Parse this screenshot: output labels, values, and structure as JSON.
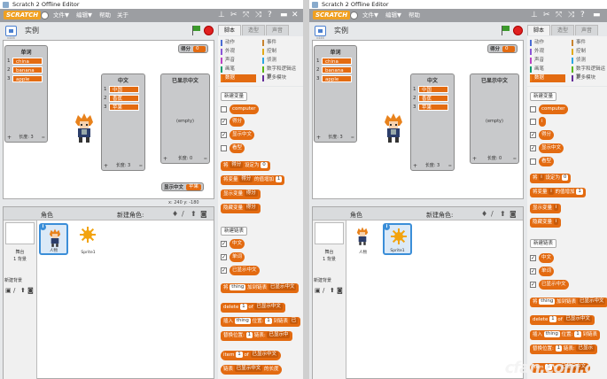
{
  "left": {
    "app_title": "Scratch 2 Offline Editor",
    "logo": "SCRATCH",
    "menu": {
      "file": "文件▼",
      "edit": "编辑▼",
      "help": "帮助",
      "about": "关于"
    },
    "stage_name": "实例",
    "version": "v446",
    "monitors": {
      "list1": {
        "title": "单词",
        "items": [
          "china",
          "banana",
          "apple"
        ],
        "length": "长度: 3"
      },
      "list2": {
        "title": "中文",
        "items": [
          "中国",
          "香蕉",
          "苹果"
        ],
        "length": "长度: 3"
      },
      "list3": {
        "title": "已显示中文",
        "empty": "(empty)",
        "length": "长度: 0"
      },
      "score_label": "得分",
      "score_value": "0",
      "show_label": "显示中文",
      "show_value": "苹果"
    },
    "coords": "x: 240  y: -180",
    "sprites_label": "角色",
    "new_sprite": "新建角色:",
    "stage_thumb": {
      "label": "舞台",
      "bg_count": "1 背景",
      "new_bg": "新建背景"
    },
    "sprites": [
      {
        "name": "人物"
      },
      {
        "name": "Sprite1"
      }
    ],
    "tabs": [
      "脚本",
      "造型",
      "声音"
    ],
    "categories": [
      {
        "label": "动作",
        "color": "#4a6cd4"
      },
      {
        "label": "事件",
        "color": "#c88330"
      },
      {
        "label": "外观",
        "color": "#8a55d7"
      },
      {
        "label": "控制",
        "color": "#e1a91a"
      },
      {
        "label": "声音",
        "color": "#bb42c3"
      },
      {
        "label": "侦测",
        "color": "#2ca5e2"
      },
      {
        "label": "画笔",
        "color": "#0e9a6c"
      },
      {
        "label": "数字和逻辑运算",
        "color": "#5cb712"
      },
      {
        "label": "数据",
        "color": "#ee7d16"
      },
      {
        "label": "更多模块",
        "color": "#632d99"
      }
    ],
    "palette": {
      "new_var": "新建变量",
      "vars": [
        "computer",
        "得分",
        "显示中文",
        "看型"
      ],
      "set_block": [
        "将",
        "得分",
        "设定为",
        "0"
      ],
      "change_block": [
        "将变量",
        "得分",
        "的值增加",
        "1"
      ],
      "show_var": [
        "显示变量",
        "得分"
      ],
      "hide_var": [
        "隐藏变量",
        "得分"
      ],
      "new_list": "新建链表",
      "lists": [
        "中文",
        "单词",
        "已显示中文"
      ],
      "add_block": [
        "将",
        "thing",
        "加到链表",
        "已显示中文"
      ],
      "delete_block": [
        "delete",
        "1",
        "of",
        "已显示中文"
      ],
      "insert_block": [
        "插入",
        "thing",
        "位置:",
        "1",
        "到链表",
        "已"
      ],
      "replace_block": [
        "替换位置:",
        "1",
        "链表:",
        "已显示中"
      ],
      "item_block": [
        "item",
        "1",
        "of",
        "已显示中文"
      ],
      "length_block": [
        "链表",
        "已显示中文",
        "的长度"
      ]
    }
  },
  "right": {
    "app_title": "Scratch 2 Offline Editor",
    "logo": "SCRATCH",
    "menu": {
      "file": "文件▼",
      "edit": "编辑▼",
      "help": "帮助"
    },
    "stage_name": "实例",
    "version": "v446",
    "monitors": {
      "list1": {
        "title": "单词",
        "items": [
          "china",
          "banana",
          "apple"
        ],
        "length": "长度: 3"
      },
      "list2": {
        "title": "中文",
        "items": [
          "中国",
          "香蕉",
          "苹果"
        ],
        "length": "长度: 3"
      },
      "list3": {
        "title": "已显示中文",
        "empty": "(empty)",
        "length": "长度: 0"
      },
      "score_label": "得分",
      "score_value": "0"
    },
    "sprites_label": "角色",
    "new_sprite": "新建角色:",
    "stage_thumb": {
      "label": "舞台",
      "bg_count": "1 背景",
      "new_bg": "新建背景"
    },
    "sprites": [
      {
        "name": "人物"
      },
      {
        "name": "Sprite1"
      }
    ],
    "tabs": [
      "脚本",
      "造型",
      "声音"
    ],
    "categories": [
      {
        "label": "动作",
        "color": "#4a6cd4"
      },
      {
        "label": "事件",
        "color": "#c88330"
      },
      {
        "label": "外观",
        "color": "#8a55d7"
      },
      {
        "label": "控制",
        "color": "#e1a91a"
      },
      {
        "label": "声音",
        "color": "#bb42c3"
      },
      {
        "label": "侦测",
        "color": "#2ca5e2"
      },
      {
        "label": "画笔",
        "color": "#0e9a6c"
      },
      {
        "label": "数字和逻辑运算",
        "color": "#5cb712"
      },
      {
        "label": "数据",
        "color": "#ee7d16"
      },
      {
        "label": "更多模块",
        "color": "#632d99"
      }
    ],
    "palette": {
      "new_var": "新建变量",
      "vars": [
        "computer",
        "i",
        "得分",
        "显示中文",
        "看型"
      ],
      "set_block": [
        "将",
        "i",
        "设定为",
        "0"
      ],
      "change_block": [
        "将变量",
        "i",
        "的值增加",
        "1"
      ],
      "show_var": [
        "显示变量",
        "i"
      ],
      "hide_var": [
        "隐藏变量",
        "i"
      ],
      "new_list": "新建链表",
      "lists": [
        "中文",
        "单词",
        "已显示中文"
      ],
      "add_block": [
        "将",
        "thing",
        "加到链表",
        "已显示中文"
      ],
      "delete_block": [
        "delete",
        "1",
        "of",
        "已显示中文"
      ],
      "insert_block": [
        "插入",
        "thing",
        "位置:",
        "1",
        "到链表"
      ],
      "replace_block": [
        "替换位置:",
        "1",
        "链表:",
        "已显示"
      ],
      "item_block": [
        "item",
        "1",
        "of",
        "已显示中文"
      ]
    },
    "watermark": "cfan.com.cn"
  }
}
